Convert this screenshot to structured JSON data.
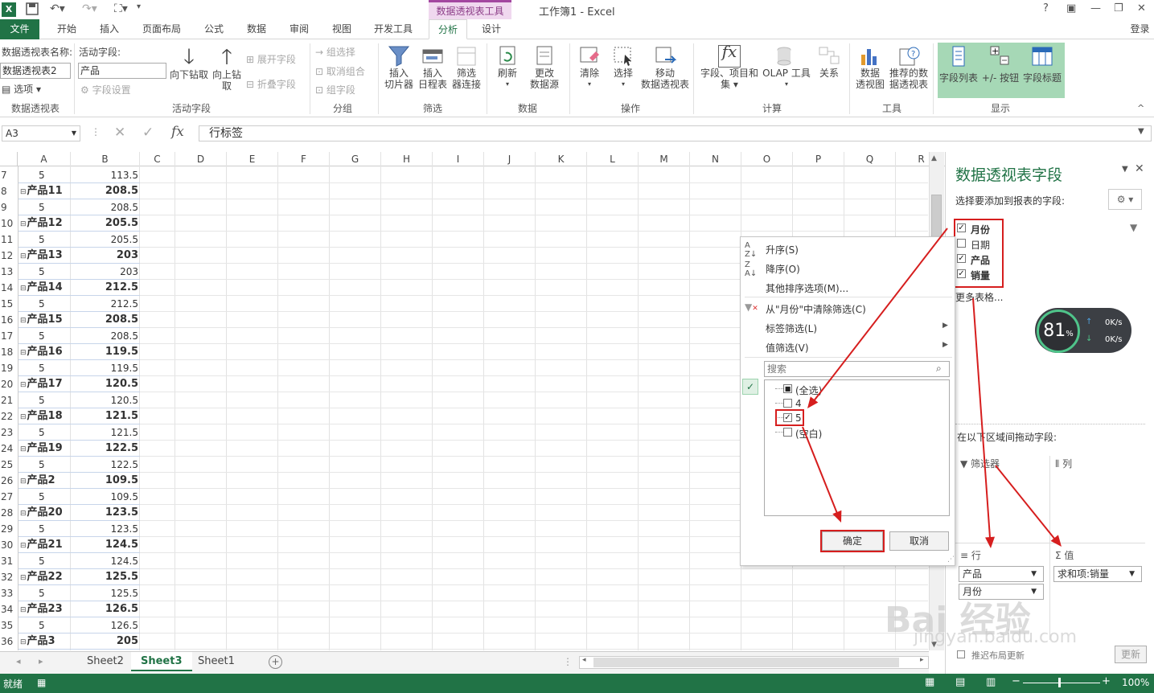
{
  "titlebar": {
    "logo": "X",
    "pivot_tools_label": "数据透视表工具",
    "window_title": "工作簿1 - Excel",
    "help": "?",
    "login": "登录"
  },
  "tabs": [
    {
      "label": "文件"
    },
    {
      "label": "开始"
    },
    {
      "label": "插入"
    },
    {
      "label": "页面布局"
    },
    {
      "label": "公式"
    },
    {
      "label": "数据"
    },
    {
      "label": "审阅"
    },
    {
      "label": "视图"
    },
    {
      "label": "开发工具"
    },
    {
      "label": "分析"
    },
    {
      "label": "设计"
    }
  ],
  "ribbon": {
    "pivot_name_label": "数据透视表名称:",
    "pivot_name_value": "数据透视表2",
    "options": "选项",
    "active_field_label": "活动字段:",
    "active_field_value": "产品",
    "field_settings": "字段设置",
    "drill_down": "向下钻取",
    "drill_up_1": "向上钻",
    "drill_up_2": "取",
    "expand_field": "展开字段",
    "collapse_field": "折叠字段",
    "group_selection": "组选择",
    "ungroup": "取消组合",
    "group_field": "组字段",
    "insert_slicer_1": "插入",
    "insert_slicer_2": "切片器",
    "insert_timeline_1": "插入",
    "insert_timeline_2": "日程表",
    "filter_conn_1": "筛选",
    "filter_conn_2": "器连接",
    "refresh": "刷新",
    "change_source_1": "更改",
    "change_source_2": "数据源",
    "clear": "清除",
    "select": "选择",
    "move_pivot_1": "移动",
    "move_pivot_2": "数据透视表",
    "fields_items_1": "字段、项目和",
    "fields_items_2": "集",
    "olap_tools": "OLAP 工具",
    "relations": "关系",
    "pivot_chart_1": "数据",
    "pivot_chart_2": "透视图",
    "recommended_1": "推荐的数",
    "recommended_2": "据透视表",
    "field_list": "字段列表",
    "plus_minus": "+/- 按钮",
    "field_headers": "字段标题",
    "groups": {
      "pivot": "数据透视表",
      "active_field": "活动字段",
      "group": "分组",
      "filter": "筛选",
      "data": "数据",
      "actions": "操作",
      "calculations": "计算",
      "tools": "工具",
      "show": "显示"
    }
  },
  "formula_bar": {
    "name_box": "A3",
    "fx": "fx",
    "content": "行标签"
  },
  "columns": [
    "A",
    "B",
    "C",
    "D",
    "E",
    "F",
    "G",
    "H",
    "I",
    "J",
    "K",
    "L",
    "M",
    "N",
    "O",
    "P",
    "Q",
    "R"
  ],
  "rows": [
    {
      "num": "7",
      "a": "5",
      "b": "113.5",
      "bold": false
    },
    {
      "num": "8",
      "a": "产品11",
      "b": "208.5",
      "bold": true
    },
    {
      "num": "9",
      "a": "5",
      "b": "208.5",
      "bold": false
    },
    {
      "num": "10",
      "a": "产品12",
      "b": "205.5",
      "bold": true
    },
    {
      "num": "11",
      "a": "5",
      "b": "205.5",
      "bold": false
    },
    {
      "num": "12",
      "a": "产品13",
      "b": "203",
      "bold": true
    },
    {
      "num": "13",
      "a": "5",
      "b": "203",
      "bold": false
    },
    {
      "num": "14",
      "a": "产品14",
      "b": "212.5",
      "bold": true
    },
    {
      "num": "15",
      "a": "5",
      "b": "212.5",
      "bold": false
    },
    {
      "num": "16",
      "a": "产品15",
      "b": "208.5",
      "bold": true
    },
    {
      "num": "17",
      "a": "5",
      "b": "208.5",
      "bold": false
    },
    {
      "num": "18",
      "a": "产品16",
      "b": "119.5",
      "bold": true
    },
    {
      "num": "19",
      "a": "5",
      "b": "119.5",
      "bold": false
    },
    {
      "num": "20",
      "a": "产品17",
      "b": "120.5",
      "bold": true
    },
    {
      "num": "21",
      "a": "5",
      "b": "120.5",
      "bold": false
    },
    {
      "num": "22",
      "a": "产品18",
      "b": "121.5",
      "bold": true
    },
    {
      "num": "23",
      "a": "5",
      "b": "121.5",
      "bold": false
    },
    {
      "num": "24",
      "a": "产品19",
      "b": "122.5",
      "bold": true
    },
    {
      "num": "25",
      "a": "5",
      "b": "122.5",
      "bold": false
    },
    {
      "num": "26",
      "a": "产品2",
      "b": "109.5",
      "bold": true
    },
    {
      "num": "27",
      "a": "5",
      "b": "109.5",
      "bold": false
    },
    {
      "num": "28",
      "a": "产品20",
      "b": "123.5",
      "bold": true
    },
    {
      "num": "29",
      "a": "5",
      "b": "123.5",
      "bold": false
    },
    {
      "num": "30",
      "a": "产品21",
      "b": "124.5",
      "bold": true
    },
    {
      "num": "31",
      "a": "5",
      "b": "124.5",
      "bold": false
    },
    {
      "num": "32",
      "a": "产品22",
      "b": "125.5",
      "bold": true
    },
    {
      "num": "33",
      "a": "5",
      "b": "125.5",
      "bold": false
    },
    {
      "num": "34",
      "a": "产品23",
      "b": "126.5",
      "bold": true
    },
    {
      "num": "35",
      "a": "5",
      "b": "126.5",
      "bold": false
    },
    {
      "num": "36",
      "a": "产品3",
      "b": "205",
      "bold": true
    }
  ],
  "filter_menu": {
    "sort_asc": "升序(S)",
    "sort_desc": "降序(O)",
    "more_sort": "其他排序选项(M)...",
    "clear_filter": "从\"月份\"中清除筛选(C)",
    "label_filter": "标签筛选(L)",
    "value_filter": "值筛选(V)",
    "search_placeholder": "搜索",
    "items": [
      {
        "label": "(全选)",
        "state": "partial"
      },
      {
        "label": "4",
        "state": "unchecked"
      },
      {
        "label": "5",
        "state": "checked"
      },
      {
        "label": "(空白)",
        "state": "unchecked"
      }
    ],
    "ok": "确定",
    "cancel": "取消"
  },
  "pivot_pane": {
    "title": "数据透视表字段",
    "subtitle": "选择要添加到报表的字段:",
    "fields": [
      {
        "label": "月份",
        "checked": true
      },
      {
        "label": "日期",
        "checked": false
      },
      {
        "label": "产品",
        "checked": true
      },
      {
        "label": "销量",
        "checked": true
      }
    ],
    "more_tables": "更多表格...",
    "drag_label": "在以下区域间拖动字段:",
    "filters_label": "筛选器",
    "columns_label": "列",
    "rows_label": "行",
    "values_label": "值",
    "row_items": [
      "产品",
      "月份"
    ],
    "value_items": [
      "求和项:销量"
    ],
    "defer_update": "推迟布局更新",
    "update_button": "更新"
  },
  "net_widget": {
    "percent": "81",
    "unit": "%",
    "up": "0K/s",
    "down": "0K/s"
  },
  "sheets": [
    "Sheet2",
    "Sheet3",
    "Sheet1"
  ],
  "active_sheet": "Sheet3",
  "status": {
    "ready": "就绪",
    "zoom": "100%"
  },
  "watermark": "Bai 经验",
  "watermark_url": "jingyan.baidu.com",
  "colors": {
    "excel_green": "#217346",
    "annotation_red": "#d61e1e",
    "pivot_tab": "#a347a0"
  }
}
